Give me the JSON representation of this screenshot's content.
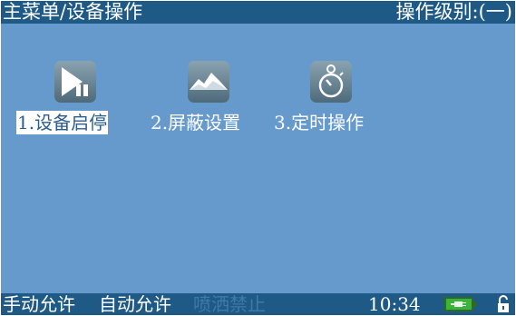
{
  "titlebar": {
    "breadcrumb": "主菜单/设备操作",
    "operator_level": "操作级别:(一)"
  },
  "menu": {
    "items": [
      {
        "label": "1.设备启停",
        "icon": "play-pause-icon",
        "selected": true
      },
      {
        "label": "2.屏蔽设置",
        "icon": "mountain-icon",
        "selected": false
      },
      {
        "label": "3.定时操作",
        "icon": "stopwatch-icon",
        "selected": false
      }
    ]
  },
  "statusbar": {
    "manual": "手动允许",
    "auto": "自动允许",
    "spray": "喷洒禁止",
    "time": "10:34",
    "battery_icon": "battery-plug-icon",
    "lock_icon": "unlocked-icon"
  },
  "colors": {
    "background": "#6699cc",
    "bar": "#1f5a86",
    "icon_tile": "#5a7483",
    "battery": "#3db33d"
  }
}
